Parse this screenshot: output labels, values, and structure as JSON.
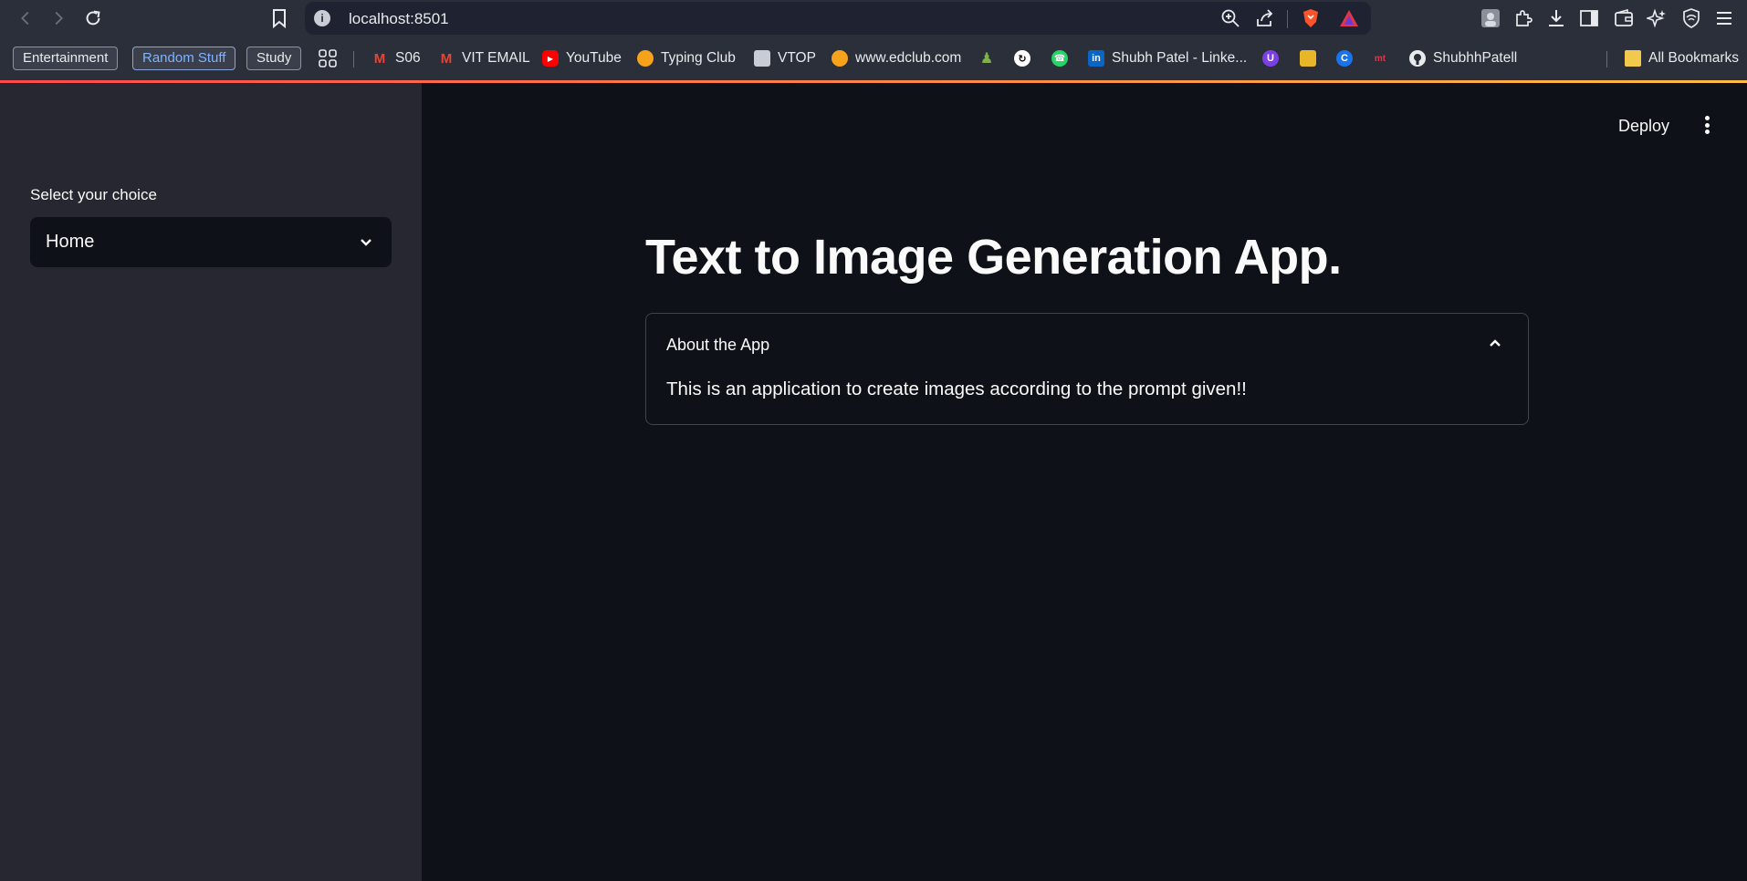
{
  "browser": {
    "url": "localhost:8501",
    "bookmark_folders": [
      "Entertainment",
      "Random Stuff",
      "Study"
    ],
    "bookmarks": [
      {
        "label": "S06",
        "icon": "gmail-icon"
      },
      {
        "label": "VIT EMAIL",
        "icon": "gmail-icon"
      },
      {
        "label": "YouTube",
        "icon": "youtube-icon"
      },
      {
        "label": "Typing Club",
        "icon": "typingclub-icon"
      },
      {
        "label": "VTOP",
        "icon": "vtop-icon"
      },
      {
        "label": "www.edclub.com",
        "icon": "edclub-icon"
      },
      {
        "label": "Shubh Patel - Linke...",
        "icon": "linkedin-icon"
      },
      {
        "label": "ShubhhPatell",
        "icon": "github-icon"
      }
    ],
    "all_bookmarks_label": "All Bookmarks"
  },
  "header": {
    "deploy_label": "Deploy"
  },
  "sidebar": {
    "select_label": "Select your choice",
    "select_value": "Home"
  },
  "main": {
    "title": "Text to Image Generation App.",
    "expander": {
      "title": "About the App",
      "body": "This is an application to create images according to the prompt given!!"
    }
  },
  "colors": {
    "app_background": "#0e1117",
    "sidebar_background": "#262730",
    "accent_gradient_start": "#ff4b4b",
    "accent_gradient_end": "#ffbd45"
  }
}
